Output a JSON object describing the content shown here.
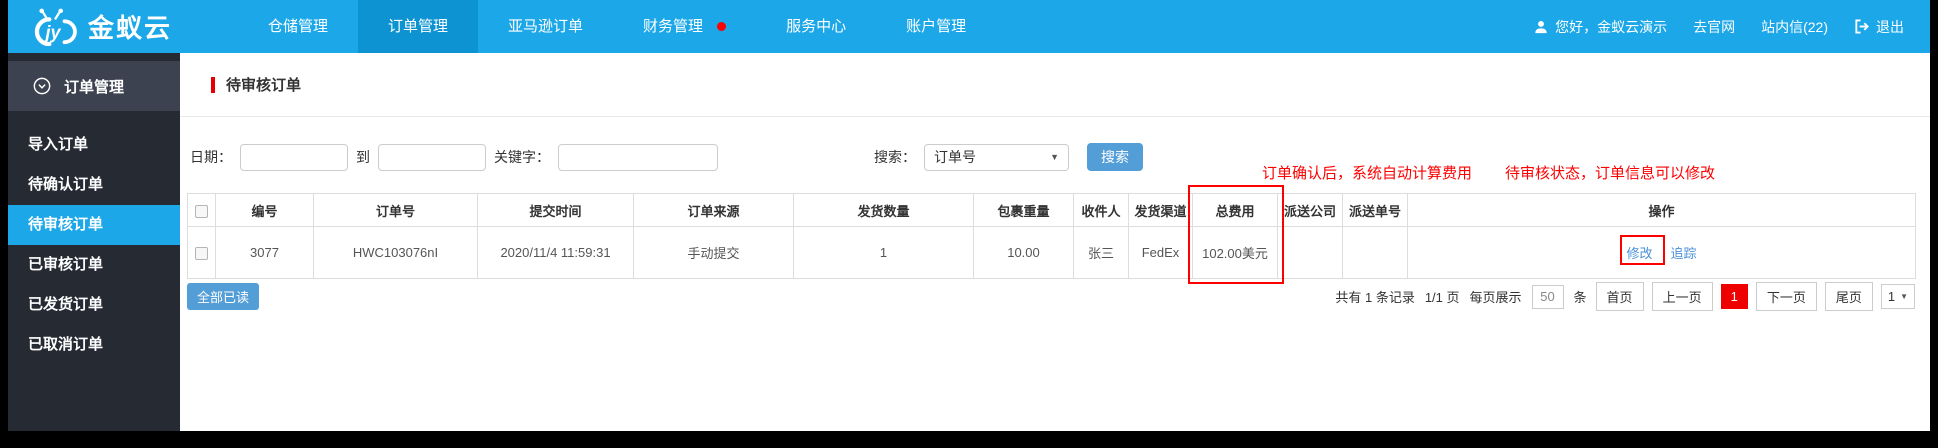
{
  "colors": {
    "topbar_blue": "#1ba7e8",
    "active_tab_blue": "#0d93d2",
    "sidebar_dark": "#262a33",
    "sidebar_header_gray": "#3d4250",
    "button_blue": "#549ed8",
    "link_blue": "#4a90d9",
    "annotation_red": "#ff0000",
    "pagination_active_red": "#ee0000"
  },
  "brand": {
    "name": "金蚁云"
  },
  "topnav": {
    "items": [
      {
        "label": "仓储管理",
        "active": false
      },
      {
        "label": "订单管理",
        "active": true
      },
      {
        "label": "亚马逊订单",
        "active": false
      },
      {
        "label": "财务管理",
        "active": false,
        "dot": true
      },
      {
        "label": "服务中心",
        "active": false
      },
      {
        "label": "账户管理",
        "active": false
      }
    ],
    "greeting": "您好，金蚁云演示",
    "official_site": "去官网",
    "mailbox": "站内信(22)",
    "logout": "退出"
  },
  "sidebar": {
    "header": "订单管理",
    "items": [
      {
        "label": "导入订单",
        "active": false
      },
      {
        "label": "待确认订单",
        "active": false
      },
      {
        "label": "待审核订单",
        "active": true
      },
      {
        "label": "已审核订单",
        "active": false
      },
      {
        "label": "已发货订单",
        "active": false
      },
      {
        "label": "已取消订单",
        "active": false
      }
    ]
  },
  "page": {
    "title": "待审核订单"
  },
  "filters": {
    "date_label": "日期：",
    "to_label": "到",
    "keyword_label": "关键字：",
    "search_label": "搜索：",
    "search_type": "订单号",
    "search_button": "搜索",
    "date_from": "",
    "date_to": "",
    "keyword": ""
  },
  "annotations": {
    "fee_note": "订单确认后，系统自动计算费用",
    "edit_note": "待审核状态，订单信息可以修改"
  },
  "table": {
    "headers": [
      "编号",
      "订单号",
      "提交时间",
      "订单来源",
      "发货数量",
      "包裹重量",
      "收件人",
      "发货渠道",
      "总费用",
      "派送公司",
      "派送单号",
      "操作"
    ],
    "rows": [
      {
        "id": "3077",
        "order_no": "HWC103076nI",
        "submit_time": "2020/11/4 11:59:31",
        "source": "手动提交",
        "ship_qty": "1",
        "weight": "10.00",
        "recipient": "张三",
        "channel": "FedEx",
        "total_fee": "102.00美元",
        "delivery_company": "",
        "tracking_no": "",
        "actions": {
          "edit": "修改",
          "track": "追踪"
        }
      }
    ]
  },
  "footer": {
    "mark_all_read": "全部已读",
    "pagination": {
      "total": "共有 1 条记录",
      "page_info": "1/1 页",
      "per_page_label": "每页展示",
      "per_page_value": "50",
      "per_page_unit": "条",
      "first": "首页",
      "prev": "上一页",
      "current": "1",
      "next": "下一页",
      "last": "尾页",
      "jump_value": "1"
    }
  },
  "glyphs": {
    "dropdown_arrow": "▼"
  }
}
